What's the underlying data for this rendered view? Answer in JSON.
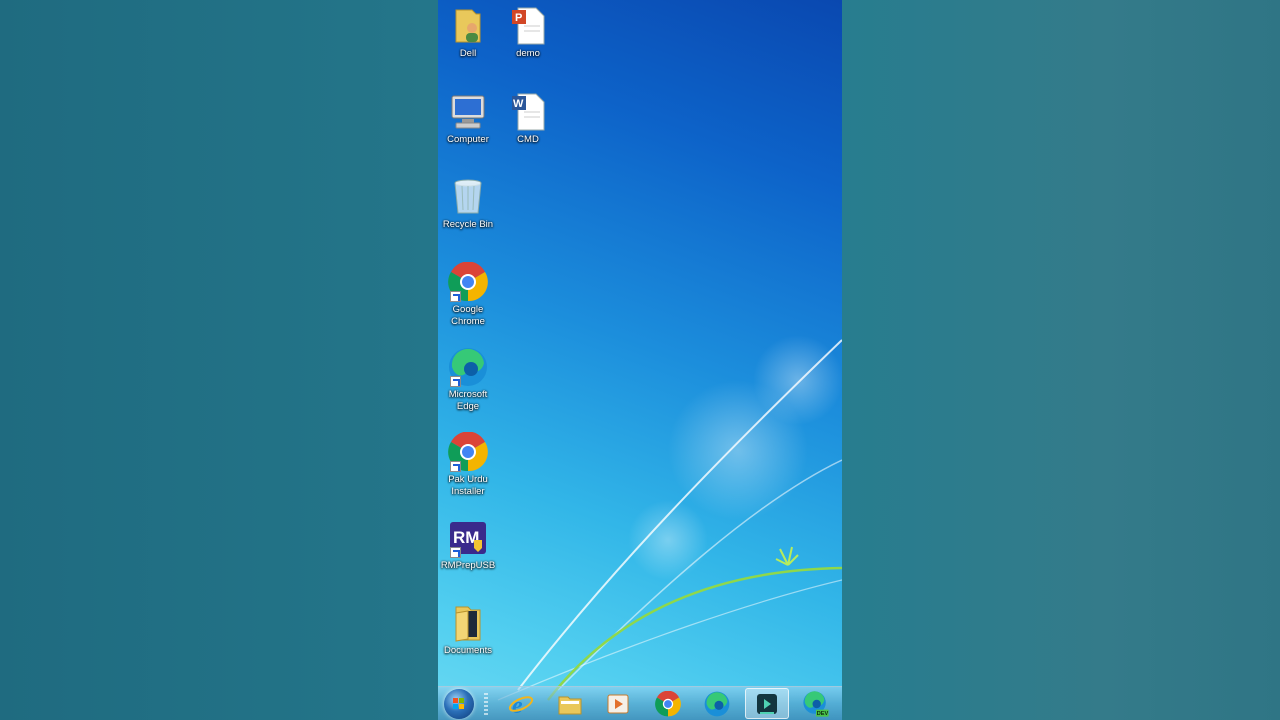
{
  "desktop": {
    "icons": [
      {
        "label": "Dell",
        "icon": "user-folder-icon"
      },
      {
        "label": "demo",
        "icon": "powerpoint-file-icon"
      },
      {
        "label": "Computer",
        "icon": "computer-icon"
      },
      {
        "label": "CMD",
        "icon": "word-file-icon"
      },
      {
        "label": "Recycle Bin",
        "icon": "recycle-bin-icon"
      },
      {
        "label": "Google Chrome",
        "icon": "chrome-icon"
      },
      {
        "label": "Microsoft Edge",
        "icon": "edge-icon"
      },
      {
        "label": "Pak Urdu Installer",
        "icon": "chrome-icon"
      },
      {
        "label": "RMPrepUSB",
        "icon": "rmprepusb-icon"
      },
      {
        "label": "Documents",
        "icon": "folder-icon"
      }
    ]
  },
  "taskbar": {
    "start": {
      "icon": "windows-start-icon"
    },
    "pinned": [
      {
        "name": "Internet Explorer",
        "icon": "internet-explorer-icon"
      },
      {
        "name": "File Explorer",
        "icon": "file-explorer-icon"
      },
      {
        "name": "Media Player",
        "icon": "media-player-icon"
      },
      {
        "name": "Google Chrome",
        "icon": "chrome-icon"
      },
      {
        "name": "Microsoft Edge",
        "icon": "edge-icon"
      },
      {
        "name": "Screen Recorder",
        "icon": "recorder-icon"
      },
      {
        "name": "Microsoft Edge Dev",
        "icon": "edge-dev-icon",
        "badge": "DEV"
      }
    ]
  },
  "colors": {
    "wallpaper_top": "#0a48b0",
    "wallpaper_bottom": "#6ad9f2",
    "outer_background": "#2a7486"
  }
}
